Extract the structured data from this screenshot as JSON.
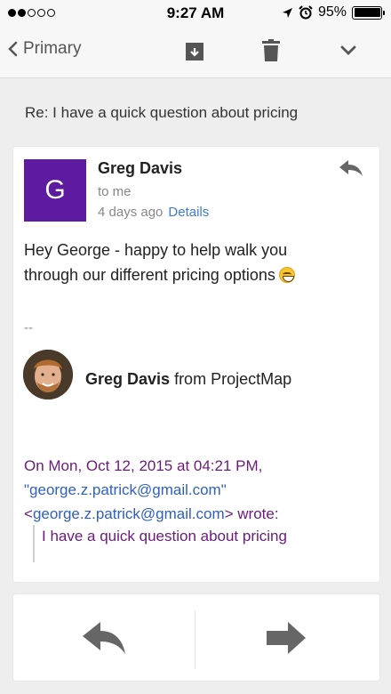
{
  "status_bar": {
    "time": "9:27 AM",
    "battery": "95%",
    "battery_level": 0.95,
    "signal_bars_filled": 2,
    "signal_bars_total": 5
  },
  "toolbar": {
    "back_label": "Primary",
    "icons": [
      "back-chevron-icon",
      "archive-icon",
      "trash-icon",
      "chevron-down-icon"
    ]
  },
  "email": {
    "subject": "Re: I have a quick question about pricing",
    "avatar_letter": "G",
    "avatar_color": "#5f1aa2",
    "sender": "Greg Davis",
    "to": "to me",
    "date": "4 days ago",
    "details_label": "Details",
    "body_line1": "Hey George - happy to help walk you",
    "body_line2": "through our different pricing options",
    "signature": {
      "dash": "--",
      "name": "Greg Davis",
      "from": "from ProjectMap"
    },
    "quote": {
      "header_line1": "On Mon, Oct 12, 2015 at 04:21 PM,",
      "email_quoted": "\"george.z.patrick@gmail.com\"",
      "email_angle_open": "<",
      "email_angle": "george.z.patrick@gmail.com",
      "wrote": "> wrote:",
      "text": "I have a quick question about pricing"
    }
  },
  "colors": {
    "quote_text": "#6a1b7a",
    "link": "#2f5fbf",
    "details": "#3b7dd8"
  }
}
